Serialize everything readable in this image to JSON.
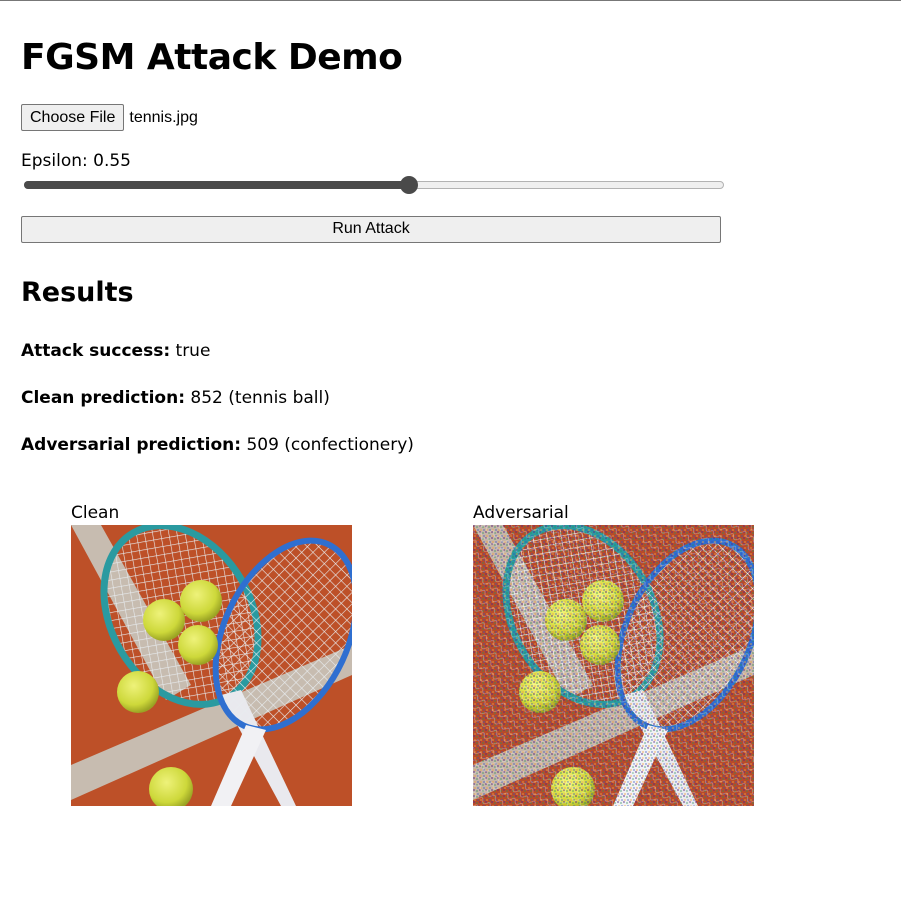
{
  "page": {
    "title": "FGSM Attack Demo"
  },
  "file_input": {
    "button_label": "Choose File",
    "file_name": "tennis.jpg"
  },
  "epsilon": {
    "label": "Epsilon: 0.55",
    "value": 0.55,
    "min": 0,
    "max": 1
  },
  "run_button": {
    "label": "Run Attack"
  },
  "results": {
    "heading": "Results",
    "attack_success_label": "Attack success:",
    "attack_success_value": "true",
    "clean_prediction_label": "Clean prediction:",
    "clean_prediction_value": "852 (tennis ball)",
    "adversarial_prediction_label": "Adversarial prediction:",
    "adversarial_prediction_value": "509 (confectionery)"
  },
  "images": {
    "clean_caption": "Clean",
    "adversarial_caption": "Adversarial"
  },
  "colors": {
    "clay": "#c4552b",
    "court_line": "#c9cfc8",
    "ball": "#d6e03a",
    "racket_blue": "#2f6fd0",
    "racket_teal": "#2a9aa0",
    "slider_fill": "#4a4a4a"
  }
}
